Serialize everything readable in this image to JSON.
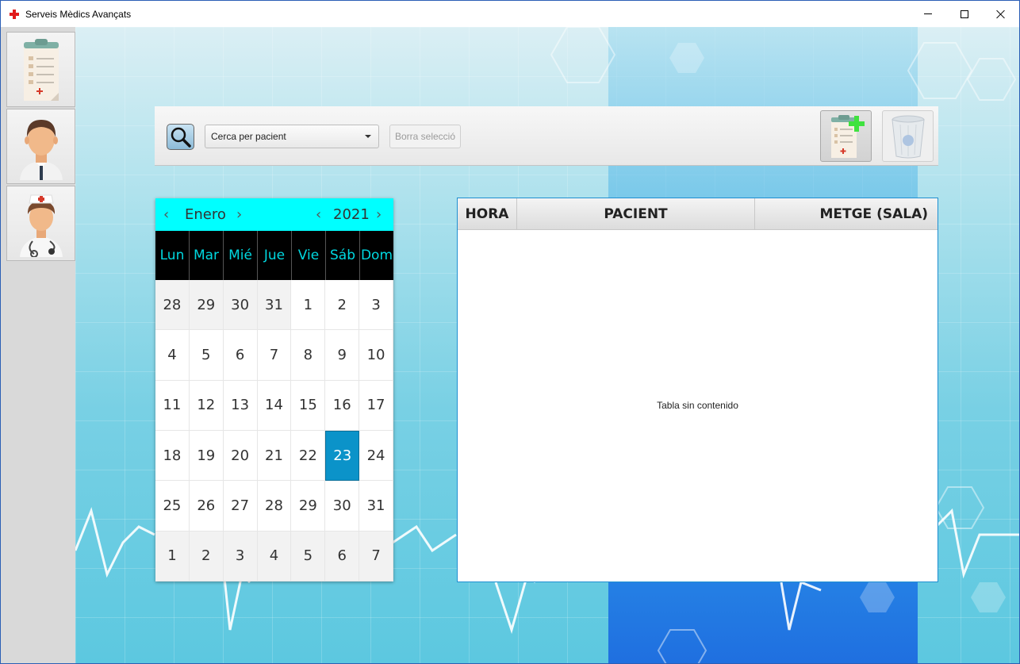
{
  "window": {
    "title": "Serveis Mèdics Avançats",
    "controls": [
      "minimize",
      "maximize",
      "close"
    ]
  },
  "sidebar": {
    "items": [
      {
        "name": "appointments",
        "icon": "clipboard-icon"
      },
      {
        "name": "doctors",
        "icon": "doctor-icon"
      },
      {
        "name": "nurses",
        "icon": "nurse-icon"
      }
    ]
  },
  "toolbar": {
    "search_icon": "magnifier-icon",
    "search_combo_value": "Cerca per pacient",
    "clear_label": "Borra selecció",
    "add_icon": "add-appointment-icon",
    "delete_icon": "recycle-bin-icon"
  },
  "calendar": {
    "month": "Enero",
    "year": "2021",
    "weekdays": [
      "Lun",
      "Mar",
      "Mié",
      "Jue",
      "Vie",
      "Sáb",
      "Dom"
    ],
    "days": [
      {
        "d": "28",
        "other": true
      },
      {
        "d": "29",
        "other": true
      },
      {
        "d": "30",
        "other": true
      },
      {
        "d": "31",
        "other": true
      },
      {
        "d": "1"
      },
      {
        "d": "2"
      },
      {
        "d": "3"
      },
      {
        "d": "4"
      },
      {
        "d": "5"
      },
      {
        "d": "6"
      },
      {
        "d": "7"
      },
      {
        "d": "8"
      },
      {
        "d": "9"
      },
      {
        "d": "10"
      },
      {
        "d": "11"
      },
      {
        "d": "12"
      },
      {
        "d": "13"
      },
      {
        "d": "14"
      },
      {
        "d": "15"
      },
      {
        "d": "16"
      },
      {
        "d": "17"
      },
      {
        "d": "18"
      },
      {
        "d": "19"
      },
      {
        "d": "20"
      },
      {
        "d": "21"
      },
      {
        "d": "22"
      },
      {
        "d": "23",
        "selected": true
      },
      {
        "d": "24"
      },
      {
        "d": "25"
      },
      {
        "d": "26"
      },
      {
        "d": "27"
      },
      {
        "d": "28"
      },
      {
        "d": "29"
      },
      {
        "d": "30"
      },
      {
        "d": "31"
      },
      {
        "d": "1",
        "other": true
      },
      {
        "d": "2",
        "other": true
      },
      {
        "d": "3",
        "other": true
      },
      {
        "d": "4",
        "other": true
      },
      {
        "d": "5",
        "other": true
      },
      {
        "d": "6",
        "other": true
      },
      {
        "d": "7",
        "other": true
      }
    ],
    "header_color": "#00ffff",
    "selected_color": "#0b93c9"
  },
  "table": {
    "columns": [
      "HORA",
      "PACIENT",
      "METGE (SALA)"
    ],
    "empty_text": "Tabla sin contenido"
  }
}
